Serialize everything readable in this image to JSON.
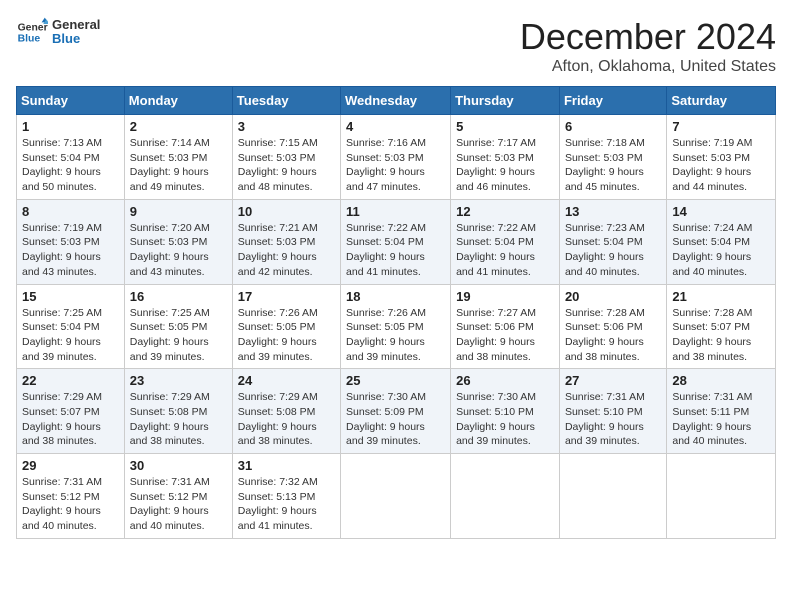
{
  "header": {
    "logo_line1": "General",
    "logo_line2": "Blue",
    "title": "December 2024",
    "subtitle": "Afton, Oklahoma, United States"
  },
  "days_of_week": [
    "Sunday",
    "Monday",
    "Tuesday",
    "Wednesday",
    "Thursday",
    "Friday",
    "Saturday"
  ],
  "weeks": [
    [
      {
        "day": "1",
        "sunrise": "7:13 AM",
        "sunset": "5:04 PM",
        "daylight": "9 hours and 50 minutes."
      },
      {
        "day": "2",
        "sunrise": "7:14 AM",
        "sunset": "5:03 PM",
        "daylight": "9 hours and 49 minutes."
      },
      {
        "day": "3",
        "sunrise": "7:15 AM",
        "sunset": "5:03 PM",
        "daylight": "9 hours and 48 minutes."
      },
      {
        "day": "4",
        "sunrise": "7:16 AM",
        "sunset": "5:03 PM",
        "daylight": "9 hours and 47 minutes."
      },
      {
        "day": "5",
        "sunrise": "7:17 AM",
        "sunset": "5:03 PM",
        "daylight": "9 hours and 46 minutes."
      },
      {
        "day": "6",
        "sunrise": "7:18 AM",
        "sunset": "5:03 PM",
        "daylight": "9 hours and 45 minutes."
      },
      {
        "day": "7",
        "sunrise": "7:19 AM",
        "sunset": "5:03 PM",
        "daylight": "9 hours and 44 minutes."
      }
    ],
    [
      {
        "day": "8",
        "sunrise": "7:19 AM",
        "sunset": "5:03 PM",
        "daylight": "9 hours and 43 minutes."
      },
      {
        "day": "9",
        "sunrise": "7:20 AM",
        "sunset": "5:03 PM",
        "daylight": "9 hours and 43 minutes."
      },
      {
        "day": "10",
        "sunrise": "7:21 AM",
        "sunset": "5:03 PM",
        "daylight": "9 hours and 42 minutes."
      },
      {
        "day": "11",
        "sunrise": "7:22 AM",
        "sunset": "5:04 PM",
        "daylight": "9 hours and 41 minutes."
      },
      {
        "day": "12",
        "sunrise": "7:22 AM",
        "sunset": "5:04 PM",
        "daylight": "9 hours and 41 minutes."
      },
      {
        "day": "13",
        "sunrise": "7:23 AM",
        "sunset": "5:04 PM",
        "daylight": "9 hours and 40 minutes."
      },
      {
        "day": "14",
        "sunrise": "7:24 AM",
        "sunset": "5:04 PM",
        "daylight": "9 hours and 40 minutes."
      }
    ],
    [
      {
        "day": "15",
        "sunrise": "7:25 AM",
        "sunset": "5:04 PM",
        "daylight": "9 hours and 39 minutes."
      },
      {
        "day": "16",
        "sunrise": "7:25 AM",
        "sunset": "5:05 PM",
        "daylight": "9 hours and 39 minutes."
      },
      {
        "day": "17",
        "sunrise": "7:26 AM",
        "sunset": "5:05 PM",
        "daylight": "9 hours and 39 minutes."
      },
      {
        "day": "18",
        "sunrise": "7:26 AM",
        "sunset": "5:05 PM",
        "daylight": "9 hours and 39 minutes."
      },
      {
        "day": "19",
        "sunrise": "7:27 AM",
        "sunset": "5:06 PM",
        "daylight": "9 hours and 38 minutes."
      },
      {
        "day": "20",
        "sunrise": "7:28 AM",
        "sunset": "5:06 PM",
        "daylight": "9 hours and 38 minutes."
      },
      {
        "day": "21",
        "sunrise": "7:28 AM",
        "sunset": "5:07 PM",
        "daylight": "9 hours and 38 minutes."
      }
    ],
    [
      {
        "day": "22",
        "sunrise": "7:29 AM",
        "sunset": "5:07 PM",
        "daylight": "9 hours and 38 minutes."
      },
      {
        "day": "23",
        "sunrise": "7:29 AM",
        "sunset": "5:08 PM",
        "daylight": "9 hours and 38 minutes."
      },
      {
        "day": "24",
        "sunrise": "7:29 AM",
        "sunset": "5:08 PM",
        "daylight": "9 hours and 38 minutes."
      },
      {
        "day": "25",
        "sunrise": "7:30 AM",
        "sunset": "5:09 PM",
        "daylight": "9 hours and 39 minutes."
      },
      {
        "day": "26",
        "sunrise": "7:30 AM",
        "sunset": "5:10 PM",
        "daylight": "9 hours and 39 minutes."
      },
      {
        "day": "27",
        "sunrise": "7:31 AM",
        "sunset": "5:10 PM",
        "daylight": "9 hours and 39 minutes."
      },
      {
        "day": "28",
        "sunrise": "7:31 AM",
        "sunset": "5:11 PM",
        "daylight": "9 hours and 40 minutes."
      }
    ],
    [
      {
        "day": "29",
        "sunrise": "7:31 AM",
        "sunset": "5:12 PM",
        "daylight": "9 hours and 40 minutes."
      },
      {
        "day": "30",
        "sunrise": "7:31 AM",
        "sunset": "5:12 PM",
        "daylight": "9 hours and 40 minutes."
      },
      {
        "day": "31",
        "sunrise": "7:32 AM",
        "sunset": "5:13 PM",
        "daylight": "9 hours and 41 minutes."
      },
      null,
      null,
      null,
      null
    ]
  ]
}
